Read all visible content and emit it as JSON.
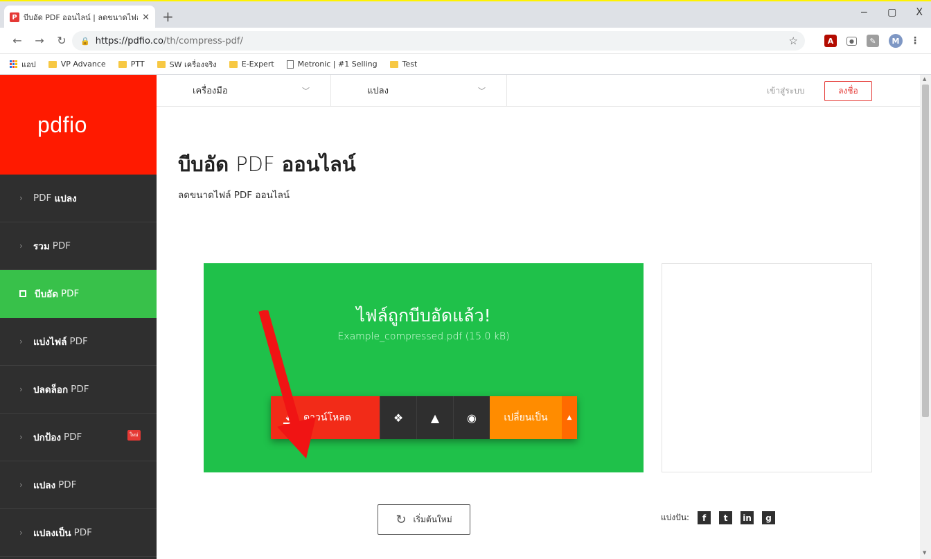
{
  "browser": {
    "tab_title": "บีบอัด PDF ออนไลน์ | ลดขนาดไฟล์ PDF",
    "tab_favicon_letter": "P",
    "new_tab": "+",
    "url_host": "https://pdfio.co",
    "url_path": "/th/compress-pdf/",
    "win_min": "−",
    "win_max": "▢",
    "win_close": "X",
    "avatar_letter": "M",
    "bookmarks": [
      {
        "label": "แอป",
        "icon": "apps-icon"
      },
      {
        "label": "VP Advance",
        "icon": "folder-icon"
      },
      {
        "label": "PTT",
        "icon": "folder-icon"
      },
      {
        "label": "SW เครื่องจริง",
        "icon": "folder-icon"
      },
      {
        "label": "E-Expert",
        "icon": "folder-icon"
      },
      {
        "label": "Metronic | #1 Selling",
        "icon": "page-icon"
      },
      {
        "label": "Test",
        "icon": "folder-icon"
      }
    ]
  },
  "site": {
    "logo": "pdfio",
    "sidebar": [
      {
        "bold": "PDF",
        "rest": "แปลง",
        "bold_first": false
      },
      {
        "bold": "รวม",
        "rest": "PDF"
      },
      {
        "bold": "บีบอัด",
        "rest": "PDF",
        "active": true
      },
      {
        "bold": "แบ่งไฟล์",
        "rest": "PDF"
      },
      {
        "bold": "ปลดล็อก",
        "rest": "PDF"
      },
      {
        "bold": "ปกป้อง",
        "rest": "PDF",
        "badge": "ใหม่"
      },
      {
        "bold": "แปลง",
        "rest": "PDF"
      },
      {
        "bold": "แปลงเป็น",
        "rest": "PDF"
      }
    ],
    "topnav": {
      "tools": "เครื่องมือ",
      "convert": "แปลง",
      "login": "เข้าสู่ระบบ",
      "signup": "ลงชื่อ"
    },
    "title_bold1": "บีบอัด",
    "title_light": "PDF",
    "title_bold2": "ออนไลน์",
    "subtitle": "ลดขนาดไฟล์ PDF ออนไลน์",
    "result": {
      "title": "ไฟล์ถูกบีบอัดแล้ว!",
      "file": "Example_compressed.pdf (15.0 kB)",
      "download": "ดาวน์โหลด",
      "convert": "เปลี่ยนเป็น"
    },
    "restart": "เริ่มต้นใหม่",
    "share_label": "แบ่งปัน:"
  },
  "colors": {
    "brand_red": "#ff1a00",
    "success_green": "#1fc14a",
    "sidebar_dark": "#2f2f2f",
    "convert_orange": "#ff8c00"
  }
}
